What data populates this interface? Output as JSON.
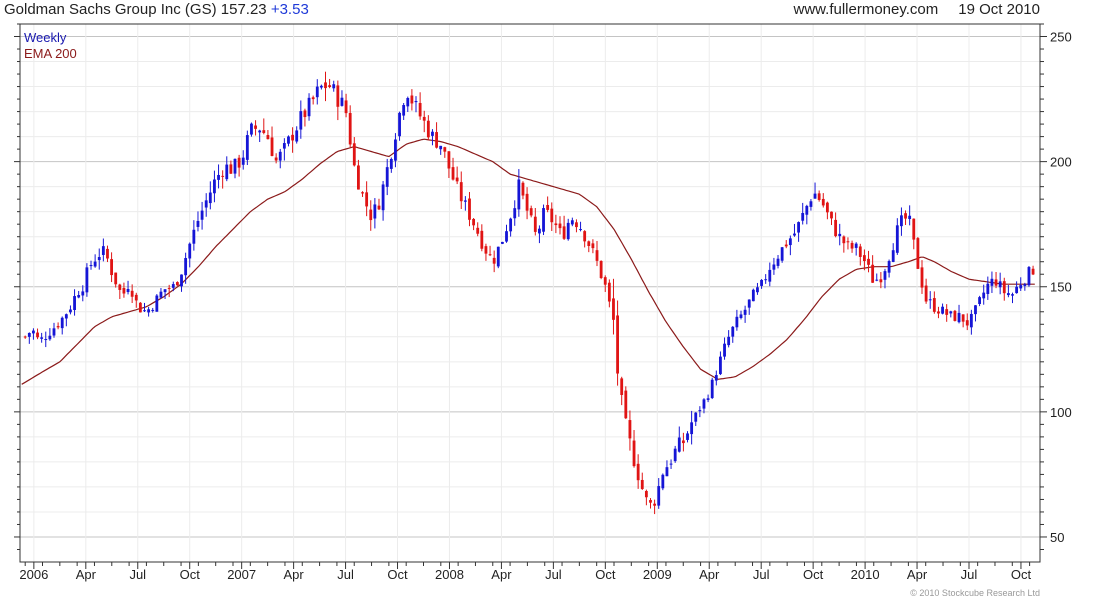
{
  "header": {
    "title": "Goldman Sachs Group Inc (GS)",
    "last": "157.23",
    "change": "+3.53",
    "site": "www.fullermoney.com",
    "date": "19 Oct 2010"
  },
  "footer": {
    "copyright": "© 2010 Stockcube Research Ltd"
  },
  "colors": {
    "up": "#1515d6",
    "down": "#e01414",
    "ema": "#8b1a1a",
    "grid": "#d8d8d8",
    "axis": "#333333"
  },
  "chart_data": {
    "type": "candlestick",
    "legend": [
      {
        "label": "Weekly",
        "color": "#1a1ab0"
      },
      {
        "label": "EMA 200",
        "color": "#8b1a1a"
      }
    ],
    "ylim": [
      40,
      255
    ],
    "y_ticks": [
      50,
      100,
      150,
      200,
      250
    ],
    "x_ticks": [
      {
        "label": "2006",
        "t": 0.5
      },
      {
        "label": "Apr",
        "t": 3.5
      },
      {
        "label": "Jul",
        "t": 6.5
      },
      {
        "label": "Oct",
        "t": 9.5
      },
      {
        "label": "2007",
        "t": 12.5
      },
      {
        "label": "Apr",
        "t": 15.5
      },
      {
        "label": "Jul",
        "t": 18.5
      },
      {
        "label": "Oct",
        "t": 21.5
      },
      {
        "label": "2008",
        "t": 24.5
      },
      {
        "label": "Apr",
        "t": 27.5
      },
      {
        "label": "Jul",
        "t": 30.5
      },
      {
        "label": "Oct",
        "t": 33.5
      },
      {
        "label": "2009",
        "t": 36.5
      },
      {
        "label": "Apr",
        "t": 39.5
      },
      {
        "label": "Jul",
        "t": 42.5
      },
      {
        "label": "Oct",
        "t": 45.5
      },
      {
        "label": "2010",
        "t": 48.5
      },
      {
        "label": "Apr",
        "t": 51.5
      },
      {
        "label": "Jul",
        "t": 54.5
      },
      {
        "label": "Oct",
        "t": 57.5
      }
    ],
    "x_range": [
      -0.3,
      58.6
    ],
    "price_anchors": [
      [
        0.0,
        130
      ],
      [
        0.4,
        133
      ],
      [
        0.8,
        128
      ],
      [
        1.4,
        132
      ],
      [
        2.0,
        136
      ],
      [
        2.6,
        142
      ],
      [
        3.0,
        148
      ],
      [
        3.3,
        150
      ],
      [
        3.7,
        158
      ],
      [
        4.2,
        163
      ],
      [
        4.6,
        164
      ],
      [
        5.0,
        156
      ],
      [
        5.6,
        146
      ],
      [
        6.0,
        152
      ],
      [
        6.5,
        142
      ],
      [
        7.0,
        140
      ],
      [
        7.5,
        144
      ],
      [
        8.0,
        149
      ],
      [
        8.6,
        150
      ],
      [
        9.0,
        156
      ],
      [
        9.5,
        167
      ],
      [
        10.0,
        177
      ],
      [
        10.5,
        185
      ],
      [
        11.0,
        193
      ],
      [
        11.5,
        198
      ],
      [
        12.0,
        197
      ],
      [
        12.5,
        201
      ],
      [
        13.0,
        212
      ],
      [
        13.5,
        214
      ],
      [
        14.0,
        210
      ],
      [
        14.5,
        200
      ],
      [
        15.0,
        205
      ],
      [
        15.5,
        212
      ],
      [
        16.0,
        218
      ],
      [
        16.5,
        223
      ],
      [
        17.0,
        229
      ],
      [
        17.5,
        231
      ],
      [
        18.0,
        226
      ],
      [
        18.5,
        221
      ],
      [
        19.0,
        198
      ],
      [
        19.5,
        186
      ],
      [
        20.0,
        178
      ],
      [
        20.5,
        185
      ],
      [
        21.0,
        200
      ],
      [
        21.5,
        216
      ],
      [
        22.0,
        230
      ],
      [
        22.5,
        222
      ],
      [
        23.0,
        216
      ],
      [
        23.5,
        210
      ],
      [
        24.0,
        207
      ],
      [
        24.5,
        197
      ],
      [
        25.0,
        188
      ],
      [
        25.5,
        181
      ],
      [
        26.0,
        174
      ],
      [
        26.5,
        166
      ],
      [
        27.0,
        160
      ],
      [
        27.5,
        168
      ],
      [
        28.0,
        178
      ],
      [
        28.5,
        190
      ],
      [
        29.0,
        180
      ],
      [
        29.5,
        170
      ],
      [
        30.0,
        180
      ],
      [
        30.5,
        176
      ],
      [
        31.0,
        170
      ],
      [
        31.5,
        178
      ],
      [
        32.0,
        175
      ],
      [
        32.5,
        168
      ],
      [
        33.0,
        160
      ],
      [
        33.5,
        150
      ],
      [
        34.0,
        135
      ],
      [
        34.3,
        108
      ],
      [
        34.7,
        93
      ],
      [
        35.2,
        80
      ],
      [
        35.6,
        70
      ],
      [
        36.0,
        62
      ],
      [
        36.4,
        65
      ],
      [
        36.8,
        76
      ],
      [
        37.2,
        80
      ],
      [
        37.6,
        85
      ],
      [
        38.0,
        88
      ],
      [
        38.5,
        96
      ],
      [
        39.0,
        102
      ],
      [
        39.5,
        108
      ],
      [
        40.0,
        118
      ],
      [
        40.5,
        128
      ],
      [
        41.0,
        135
      ],
      [
        41.5,
        140
      ],
      [
        42.0,
        146
      ],
      [
        42.5,
        150
      ],
      [
        43.0,
        158
      ],
      [
        43.5,
        163
      ],
      [
        44.0,
        168
      ],
      [
        44.5,
        172
      ],
      [
        45.0,
        180
      ],
      [
        45.5,
        188
      ],
      [
        46.0,
        184
      ],
      [
        46.5,
        176
      ],
      [
        47.0,
        170
      ],
      [
        47.5,
        166
      ],
      [
        48.0,
        165
      ],
      [
        48.5,
        160
      ],
      [
        49.0,
        152
      ],
      [
        49.5,
        155
      ],
      [
        50.0,
        165
      ],
      [
        50.5,
        175
      ],
      [
        51.0,
        178
      ],
      [
        51.5,
        160
      ],
      [
        52.0,
        145
      ],
      [
        52.5,
        142
      ],
      [
        53.0,
        140
      ],
      [
        53.5,
        138
      ],
      [
        54.0,
        138
      ],
      [
        54.5,
        135
      ],
      [
        55.0,
        142
      ],
      [
        55.5,
        150
      ],
      [
        56.0,
        153
      ],
      [
        56.5,
        148
      ],
      [
        57.0,
        147
      ],
      [
        57.5,
        152
      ],
      [
        58.2,
        157
      ]
    ],
    "ema_anchors": [
      [
        -0.2,
        111
      ],
      [
        1.0,
        116
      ],
      [
        2.0,
        120
      ],
      [
        3.0,
        127
      ],
      [
        4.0,
        134
      ],
      [
        5.0,
        138
      ],
      [
        6.0,
        140
      ],
      [
        7.0,
        142
      ],
      [
        8.0,
        146
      ],
      [
        9.0,
        151
      ],
      [
        10.0,
        158
      ],
      [
        11.0,
        166
      ],
      [
        12.0,
        173
      ],
      [
        13.0,
        180
      ],
      [
        14.0,
        185
      ],
      [
        15.0,
        188
      ],
      [
        16.0,
        193
      ],
      [
        17.0,
        199
      ],
      [
        18.0,
        204
      ],
      [
        19.0,
        206
      ],
      [
        20.0,
        204
      ],
      [
        21.0,
        202
      ],
      [
        22.0,
        207
      ],
      [
        23.0,
        209
      ],
      [
        24.0,
        208
      ],
      [
        25.0,
        206
      ],
      [
        26.0,
        203
      ],
      [
        27.0,
        200
      ],
      [
        28.0,
        195
      ],
      [
        29.0,
        193
      ],
      [
        30.0,
        191
      ],
      [
        31.0,
        189
      ],
      [
        32.0,
        187
      ],
      [
        33.0,
        182
      ],
      [
        34.0,
        173
      ],
      [
        35.0,
        161
      ],
      [
        36.0,
        148
      ],
      [
        37.0,
        136
      ],
      [
        38.0,
        126
      ],
      [
        39.0,
        117
      ],
      [
        40.0,
        113
      ],
      [
        41.0,
        114
      ],
      [
        42.0,
        118
      ],
      [
        43.0,
        123
      ],
      [
        44.0,
        129
      ],
      [
        45.0,
        137
      ],
      [
        46.0,
        146
      ],
      [
        47.0,
        153
      ],
      [
        48.0,
        157
      ],
      [
        49.0,
        158
      ],
      [
        50.0,
        158
      ],
      [
        51.0,
        160
      ],
      [
        51.8,
        162
      ],
      [
        52.5,
        160
      ],
      [
        53.5,
        156
      ],
      [
        54.5,
        153
      ],
      [
        55.5,
        152
      ],
      [
        56.5,
        151
      ],
      [
        57.5,
        151
      ],
      [
        58.3,
        151
      ]
    ],
    "n_bars": 246
  }
}
